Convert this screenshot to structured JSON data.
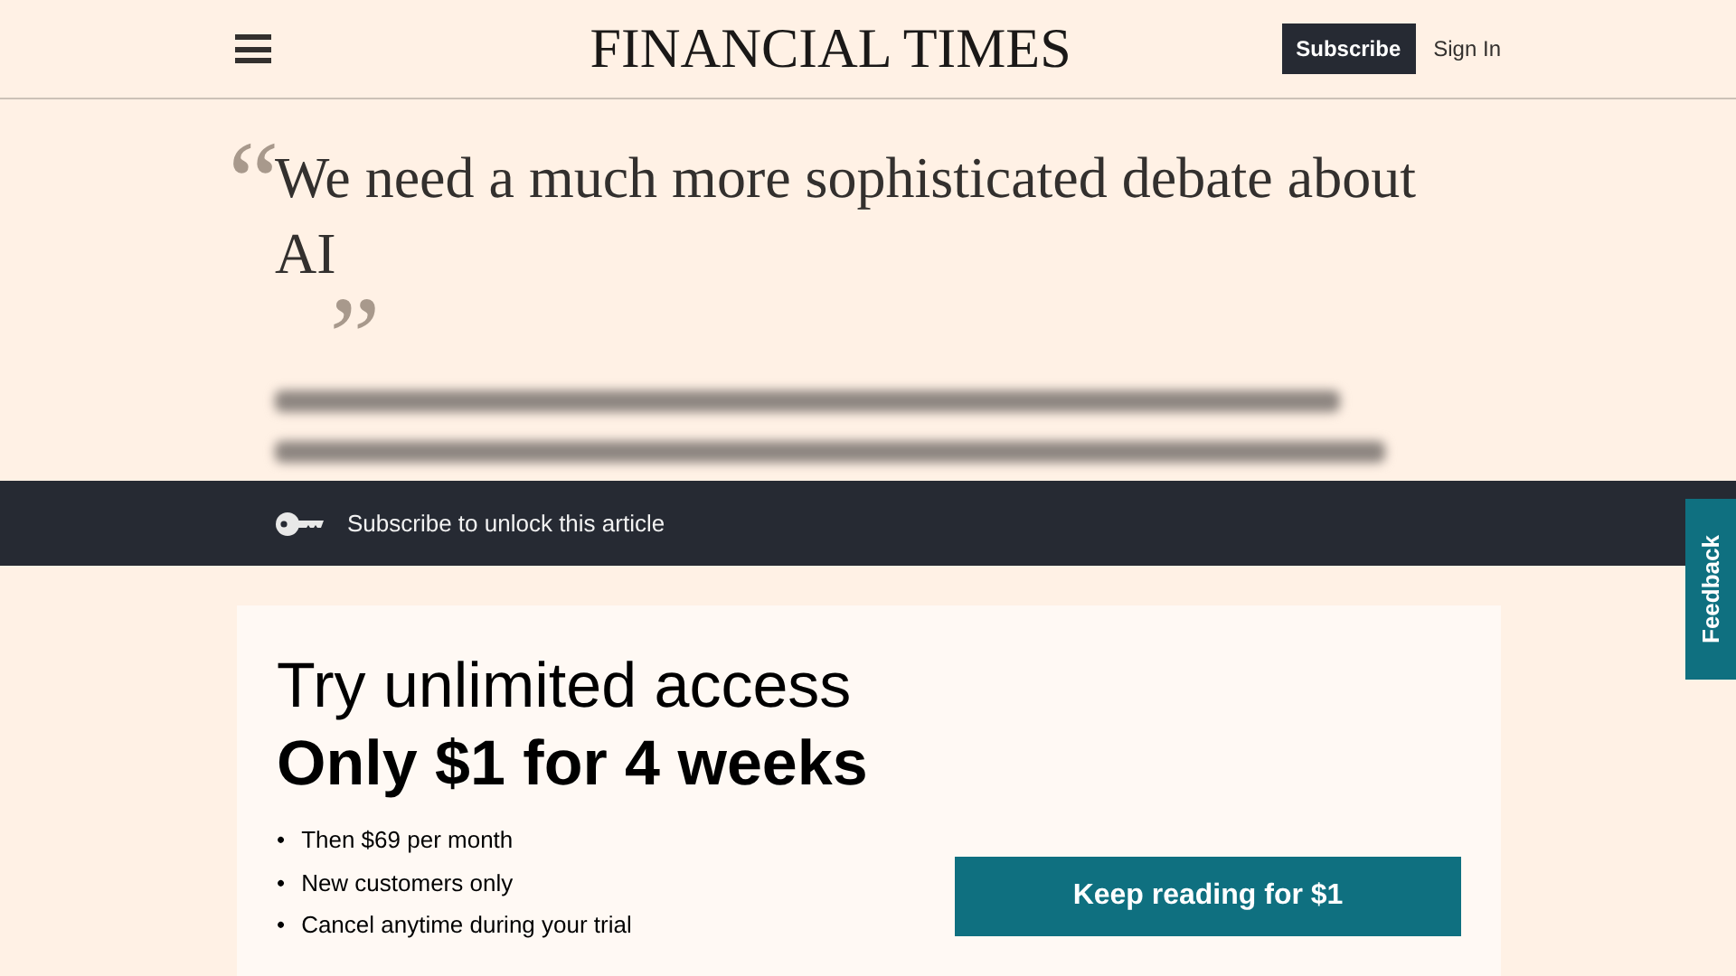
{
  "header": {
    "logo": "FINANCIAL TIMES",
    "subscribe_button": "Subscribe",
    "sign_in_link": "Sign In"
  },
  "quote": {
    "open_mark": "“",
    "close_mark": "”",
    "headline": "We need a much more sophisticated debate about AI"
  },
  "unlock_bar": {
    "text": "Subscribe to unlock this article"
  },
  "offer": {
    "title": "Try unlimited access",
    "price": "Only $1 for 4 weeks",
    "points": [
      {
        "bullet": "•",
        "text": "Then $69 per month"
      },
      {
        "bullet": "•",
        "text": "New customers only"
      },
      {
        "bullet": "•",
        "text": "Cancel anytime during your trial"
      }
    ],
    "button": "Keep reading for $1"
  },
  "feedback_tab": "Feedback"
}
